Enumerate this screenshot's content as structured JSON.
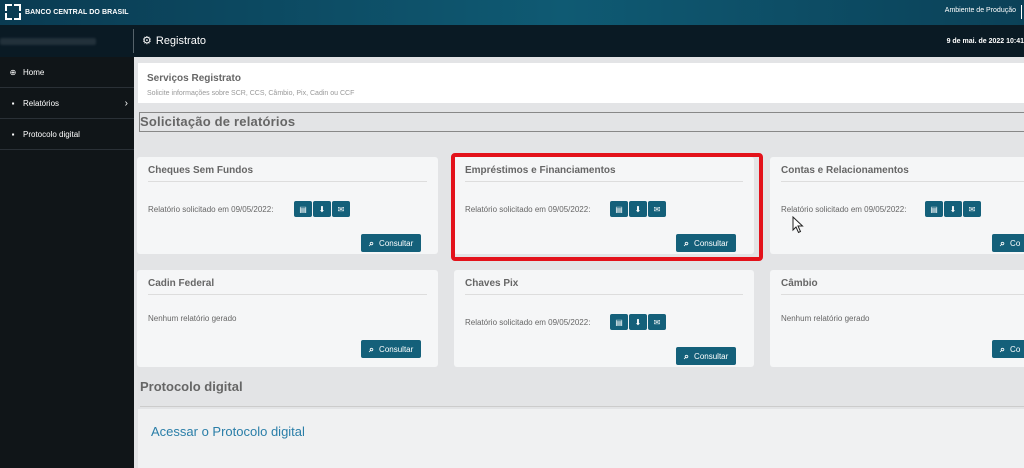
{
  "topbar": {
    "brand": "BANCO CENTRAL DO BRASIL",
    "environment": "Ambiente de Produção"
  },
  "header": {
    "title": "Registrato",
    "datetime": "9 de mai. de 2022 10:41"
  },
  "sidebar": {
    "items": [
      {
        "label": "Home",
        "icon": "globe-icon"
      },
      {
        "label": "Relatórios",
        "icon": "document-icon"
      },
      {
        "label": "Protocolo digital",
        "icon": "document-icon"
      }
    ]
  },
  "services": {
    "title": "Serviços Registrato",
    "subtitle": "Solicite informações sobre SCR, CCS, Câmbio, Pix, Cadin ou CCF"
  },
  "section": {
    "title": "Solicitação de relatórios"
  },
  "cards": [
    {
      "title": "Cheques Sem Fundos",
      "status": "Relatório solicitado em 09/05/2022:",
      "button": "Consultar"
    },
    {
      "title": "Empréstimos e Financiamentos",
      "status": "Relatório solicitado em 09/05/2022:",
      "button": "Consultar"
    },
    {
      "title": "Contas e Relacionamentos",
      "status": "Relatório solicitado em 09/05/2022:",
      "button": "Co"
    },
    {
      "title": "Cadin Federal",
      "status": "Nenhum relatório gerado",
      "button": "Consultar"
    },
    {
      "title": "Chaves Pix",
      "status": "Relatório solicitado em 09/05/2022:",
      "button": "Consultar"
    },
    {
      "title": "Câmbio",
      "status": "Nenhum relatório gerado",
      "button": "Co"
    }
  ],
  "protocolo": {
    "title": "Protocolo digital",
    "link": "Acessar o Protocolo digital"
  },
  "colors": {
    "accent": "#14607a",
    "highlight": "#e3121b",
    "topbar": "#0f5a73",
    "header": "#0a1a24",
    "sidebar": "#101518"
  }
}
